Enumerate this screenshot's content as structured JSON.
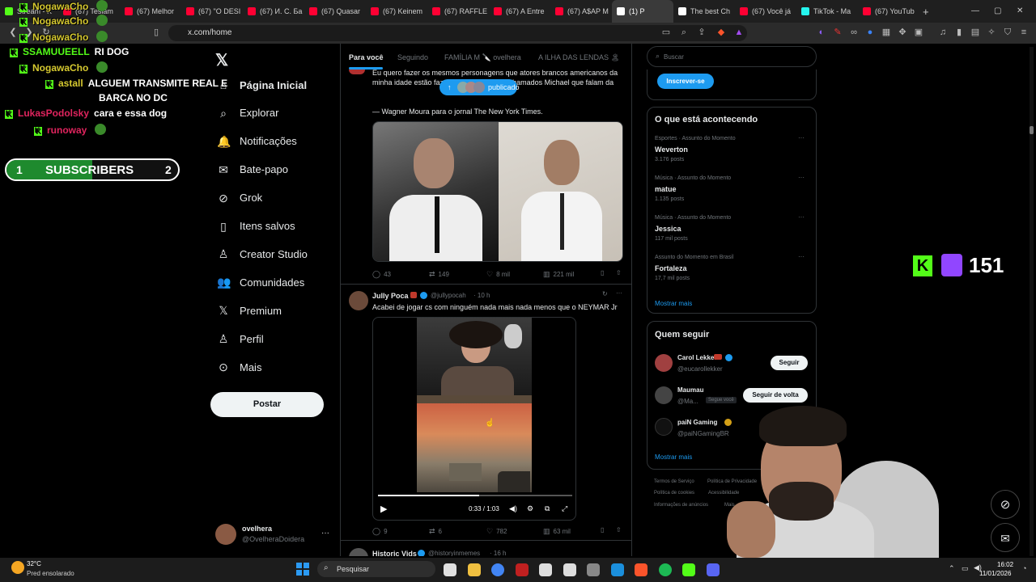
{
  "browser": {
    "tabs": [
      {
        "label": "Stream - K",
        "color": "#53fc18"
      },
      {
        "label": "(67) Tesiam",
        "color": "#ff0033"
      },
      {
        "label": "(67) Melhor",
        "color": "#ff0033"
      },
      {
        "label": "(67) \"O DESI",
        "color": "#ff0033"
      },
      {
        "label": "(67) И. С. Ба",
        "color": "#ff0033"
      },
      {
        "label": "(67) Quasar",
        "color": "#ff0033"
      },
      {
        "label": "(67) Keinem",
        "color": "#ff0033"
      },
      {
        "label": "(67) RAFFLE",
        "color": "#ff0033"
      },
      {
        "label": "(67) A Entre",
        "color": "#ff0033"
      },
      {
        "label": "(67) A$AP M",
        "color": "#ff0033"
      },
      {
        "label": "(1) P",
        "color": "#ffffff"
      },
      {
        "label": "The best Ch",
        "color": "#ffffff"
      },
      {
        "label": "(67) Você já",
        "color": "#ff0033"
      },
      {
        "label": "TikTok - Ma",
        "color": "#25f4ee"
      },
      {
        "label": "(67) YouTub",
        "color": "#ff0033"
      }
    ],
    "new_tab": "+",
    "url": "x.com/home"
  },
  "chat": [
    {
      "user": "NogawaCho",
      "user_color": "#d6c930",
      "message": ""
    },
    {
      "user": "NogawaCho",
      "user_color": "#d6c930",
      "message": ""
    },
    {
      "user": "NogawaCho",
      "user_color": "#d6c930",
      "message": ""
    },
    {
      "user": "SSAMUUEELL",
      "user_color": "#53fc18",
      "message": "RI DOG"
    },
    {
      "user": "NogawaCho",
      "user_color": "#d6c930",
      "message": ""
    },
    {
      "user": "astall",
      "user_color": "#d6c930",
      "message": "ALGUEM TRANSMITE REAL E"
    },
    {
      "user": "",
      "user_color": "#ffffff",
      "message": "BARCA NO DC"
    },
    {
      "user": "LukasPodolsky",
      "user_color": "#e0245e",
      "message": "cara e essa dog"
    },
    {
      "user": "runoway",
      "user_color": "#e0245e",
      "message": ""
    }
  ],
  "subs_goal": {
    "current": "1",
    "label": "SUBSCRIBERS",
    "target": "2",
    "progress": 0.5
  },
  "nav": {
    "items": [
      "Página Inicial",
      "Explorar",
      "Notificações",
      "Bate-papo",
      "Grok",
      "Itens salvos",
      "Creator Studio",
      "Comunidades",
      "Premium",
      "Perfil",
      "Mais"
    ],
    "post_label": "Postar",
    "user_name": "ovelhera",
    "user_handle": "@OvelheraDoidera",
    "more": "···"
  },
  "feed": {
    "tabs": [
      "Para você",
      "Seguindo",
      "FAMÍLIA M 🔪 ovelhera",
      "A ILHA DAS LENDAS 🏝"
    ],
    "new_posts_pill": "publicado",
    "tweet1": {
      "text": "Eu quero fazer os mesmos personagens que atores brancos americanos da minha idade estão fazendo. Personagens chamados Michael que falam da",
      "quote": "— Wagner Moura para o jornal The New York Times.",
      "replies": "43",
      "retweets": "149",
      "likes": "8 mil",
      "views": "221 mil"
    },
    "tweet2": {
      "name": "Jully Poca",
      "handle": "@jullypocah",
      "time": "· 10 h",
      "text": "Acabei de jogar cs com ninguém nada mais nada menos que o NEYMAR Jr",
      "video_time": "0:33 / 1:03",
      "video_progress": 0.52,
      "replies": "9",
      "retweets": "6",
      "likes": "782",
      "views": "63 mil"
    },
    "tweet3": {
      "name": "Historic Vids",
      "handle": "@historyinmemes",
      "time": "· 16 h"
    }
  },
  "right": {
    "search_placeholder": "Buscar",
    "subscribe_label": "Inscrever-se",
    "trends_title": "O que está acontecendo",
    "trends": [
      {
        "meta": "Esportes · Assunto do Momento",
        "name": "Weverton",
        "count": "3.176 posts"
      },
      {
        "meta": "Música · Assunto do Momento",
        "name": "matue",
        "count": "1.135 posts"
      },
      {
        "meta": "Música · Assunto do Momento",
        "name": "Jessica",
        "count": "117 mil posts"
      },
      {
        "meta": "Assunto do Momento em Brasil",
        "name": "Fortaleza",
        "count": "17,7 mil posts"
      }
    ],
    "show_more": "Mostrar mais",
    "follow_title": "Quem seguir",
    "follow": [
      {
        "name": "Carol Lekker",
        "handle": "@eucarollekker",
        "button": "Seguir",
        "badge": ""
      },
      {
        "name": "Maumau",
        "handle": "@Ma...",
        "button": "Seguir de volta",
        "badge": "Segue você"
      },
      {
        "name": "paiN Gaming",
        "handle": "@paiNGamingBR",
        "button": "",
        "badge": ""
      }
    ],
    "follow_more": "Mostrar mais",
    "footer": [
      "Termos de Serviço",
      "Política de Privacidade",
      "Política de cookies",
      "Acessibilidade",
      "Informações de anúncios",
      "Mais ···",
      "© 2026"
    ]
  },
  "viewer_count": "151",
  "taskbar": {
    "weather_temp": "32°C",
    "weather_desc": "Pred ensolarado",
    "search_label": "Pesquisar",
    "time": "16:02",
    "date": "11/01/2026"
  }
}
